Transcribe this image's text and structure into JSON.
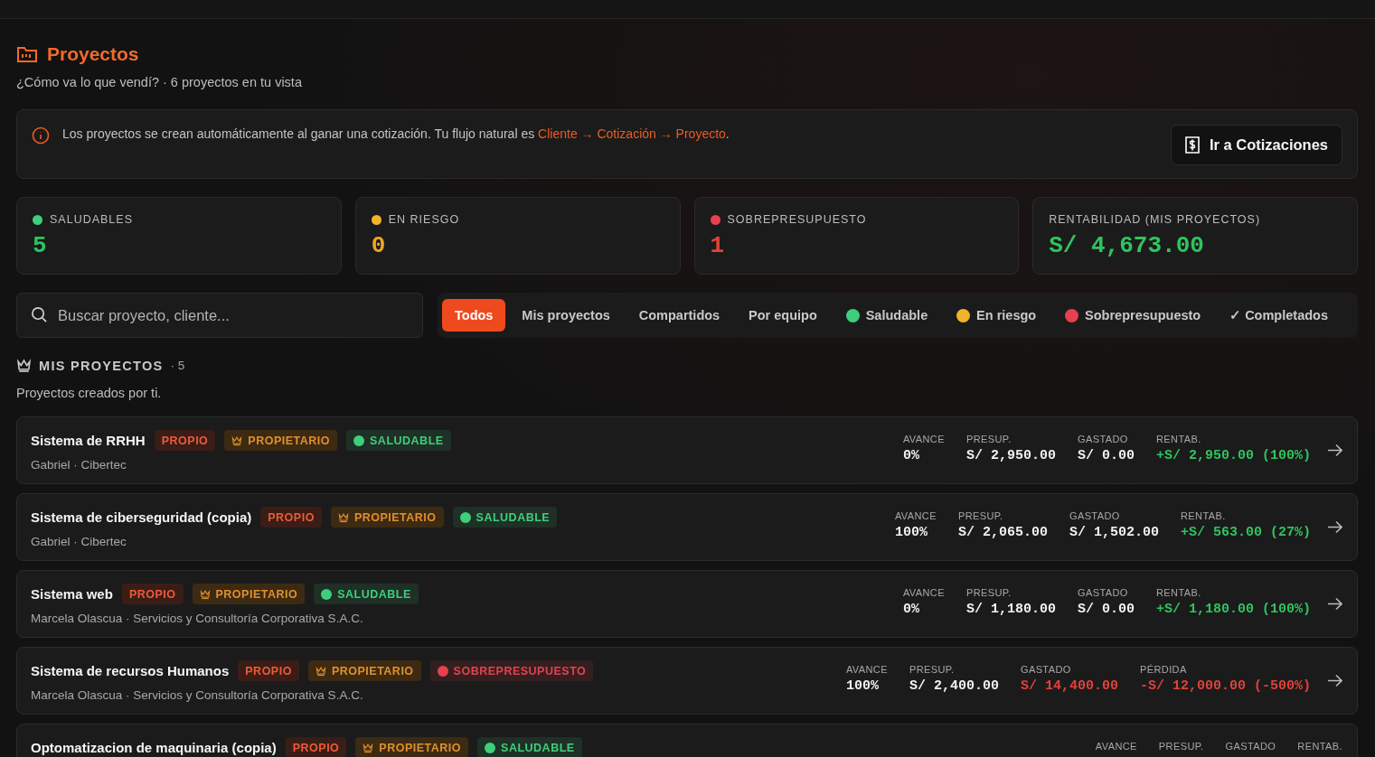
{
  "header": {
    "title": "Proyectos",
    "subtitle": "¿Cómo va lo que vendí? · 6 proyectos en tu vista"
  },
  "notice": {
    "text": "Los proyectos se crean automáticamente al ganar una cotización. Tu flujo natural es ",
    "link": "Cliente → Cotización → Proyecto",
    "end": ".",
    "button": "Ir a Cotizaciones"
  },
  "stats": [
    {
      "label": "SALUDABLES",
      "value": "5",
      "color": "#3ecf7a",
      "kind": "positive"
    },
    {
      "label": "EN RIESGO",
      "value": "0",
      "color": "#f0b429",
      "kind": "warning"
    },
    {
      "label": "SOBREPRESUPUESTO",
      "value": "1",
      "color": "#e5424d",
      "kind": "negative"
    },
    {
      "label": "RENTABILIDAD (MIS PROYECTOS)",
      "value": "S/ 4,673.00",
      "kind": "positive"
    }
  ],
  "search": {
    "placeholder": "Buscar proyecto, cliente..."
  },
  "filters": [
    {
      "label": "Todos",
      "selected": true
    },
    {
      "label": "Mis proyectos",
      "selected": false
    },
    {
      "label": "Compartidos",
      "selected": false
    },
    {
      "label": "Por equipo",
      "selected": false
    },
    {
      "label": "Saludable",
      "selected": false,
      "color": "#3ecf7a"
    },
    {
      "label": "En riesgo",
      "selected": false,
      "color": "#f0b429"
    },
    {
      "label": "Sobrepresupuesto",
      "selected": false,
      "color": "#e5424d"
    },
    {
      "label": "✓ Completados",
      "selected": false
    }
  ],
  "section": {
    "title": "MIS PROYECTOS",
    "count": "· 5",
    "subtitle": "Proyectos creados por ti."
  },
  "projects": [
    {
      "name": "Sistema de RRHH",
      "meta": "Gabriel · Cibertec",
      "badges": [
        {
          "kind": "own",
          "label": "PROPIO"
        },
        {
          "kind": "owner",
          "label": "PROPIETARIO"
        },
        {
          "kind": "status",
          "label": "SALUDABLE",
          "color": "#3ecf7a"
        }
      ],
      "metrics": [
        {
          "label": "AVANCE",
          "value": "0%",
          "kind": "neutral"
        },
        {
          "label": "PRESUP.",
          "value": "S/ 2,950.00",
          "kind": "neutral"
        },
        {
          "label": "GASTADO",
          "value": "S/ 0.00",
          "kind": "neutral"
        },
        {
          "label": "RENTAB.",
          "value": "+S/ 2,950.00 (100%)",
          "kind": "positive"
        }
      ]
    },
    {
      "name": "Sistema de ciberseguridad (copia)",
      "meta": "Gabriel · Cibertec",
      "badges": [
        {
          "kind": "own",
          "label": "PROPIO"
        },
        {
          "kind": "owner",
          "label": "PROPIETARIO"
        },
        {
          "kind": "status",
          "label": "SALUDABLE",
          "color": "#3ecf7a"
        }
      ],
      "metrics": [
        {
          "label": "AVANCE",
          "value": "100%",
          "kind": "neutral"
        },
        {
          "label": "PRESUP.",
          "value": "S/ 2,065.00",
          "kind": "neutral"
        },
        {
          "label": "GASTADO",
          "value": "S/ 1,502.00",
          "kind": "neutral"
        },
        {
          "label": "RENTAB.",
          "value": "+S/ 563.00 (27%)",
          "kind": "positive"
        }
      ]
    },
    {
      "name": "Sistema web",
      "meta": "Marcela Olascua · Servicios y Consultoría Corporativa S.A.C.",
      "badges": [
        {
          "kind": "own",
          "label": "PROPIO"
        },
        {
          "kind": "owner",
          "label": "PROPIETARIO"
        },
        {
          "kind": "status",
          "label": "SALUDABLE",
          "color": "#3ecf7a"
        }
      ],
      "metrics": [
        {
          "label": "AVANCE",
          "value": "0%",
          "kind": "neutral"
        },
        {
          "label": "PRESUP.",
          "value": "S/ 1,180.00",
          "kind": "neutral"
        },
        {
          "label": "GASTADO",
          "value": "S/ 0.00",
          "kind": "neutral"
        },
        {
          "label": "RENTAB.",
          "value": "+S/ 1,180.00 (100%)",
          "kind": "positive"
        }
      ]
    },
    {
      "name": "Sistema de recursos Humanos",
      "meta": "Marcela Olascua · Servicios y Consultoría Corporativa S.A.C.",
      "badges": [
        {
          "kind": "own",
          "label": "PROPIO"
        },
        {
          "kind": "owner",
          "label": "PROPIETARIO"
        },
        {
          "kind": "status",
          "label": "SOBREPRESUPUESTO",
          "color": "#e5424d"
        }
      ],
      "metrics": [
        {
          "label": "AVANCE",
          "value": "100%",
          "kind": "neutral"
        },
        {
          "label": "PRESUP.",
          "value": "S/ 2,400.00",
          "kind": "neutral"
        },
        {
          "label": "GASTADO",
          "value": "S/ 14,400.00",
          "kind": "negative"
        },
        {
          "label": "PÉRDIDA",
          "value": "-S/ 12,000.00 (-500%)",
          "kind": "negative"
        }
      ]
    },
    {
      "name": "Optomatizacion de maquinaria (copia)",
      "badges": [
        {
          "kind": "own",
          "label": "PROPIO"
        },
        {
          "kind": "owner",
          "label": "PROPIETARIO"
        },
        {
          "kind": "status",
          "label": "SALUDABLE",
          "color": "#3ecf7a"
        }
      ],
      "metrics": [
        {
          "label": "AVANCE"
        },
        {
          "label": "PRESUP."
        },
        {
          "label": "GASTADO"
        },
        {
          "label": "RENTAB."
        }
      ]
    }
  ]
}
